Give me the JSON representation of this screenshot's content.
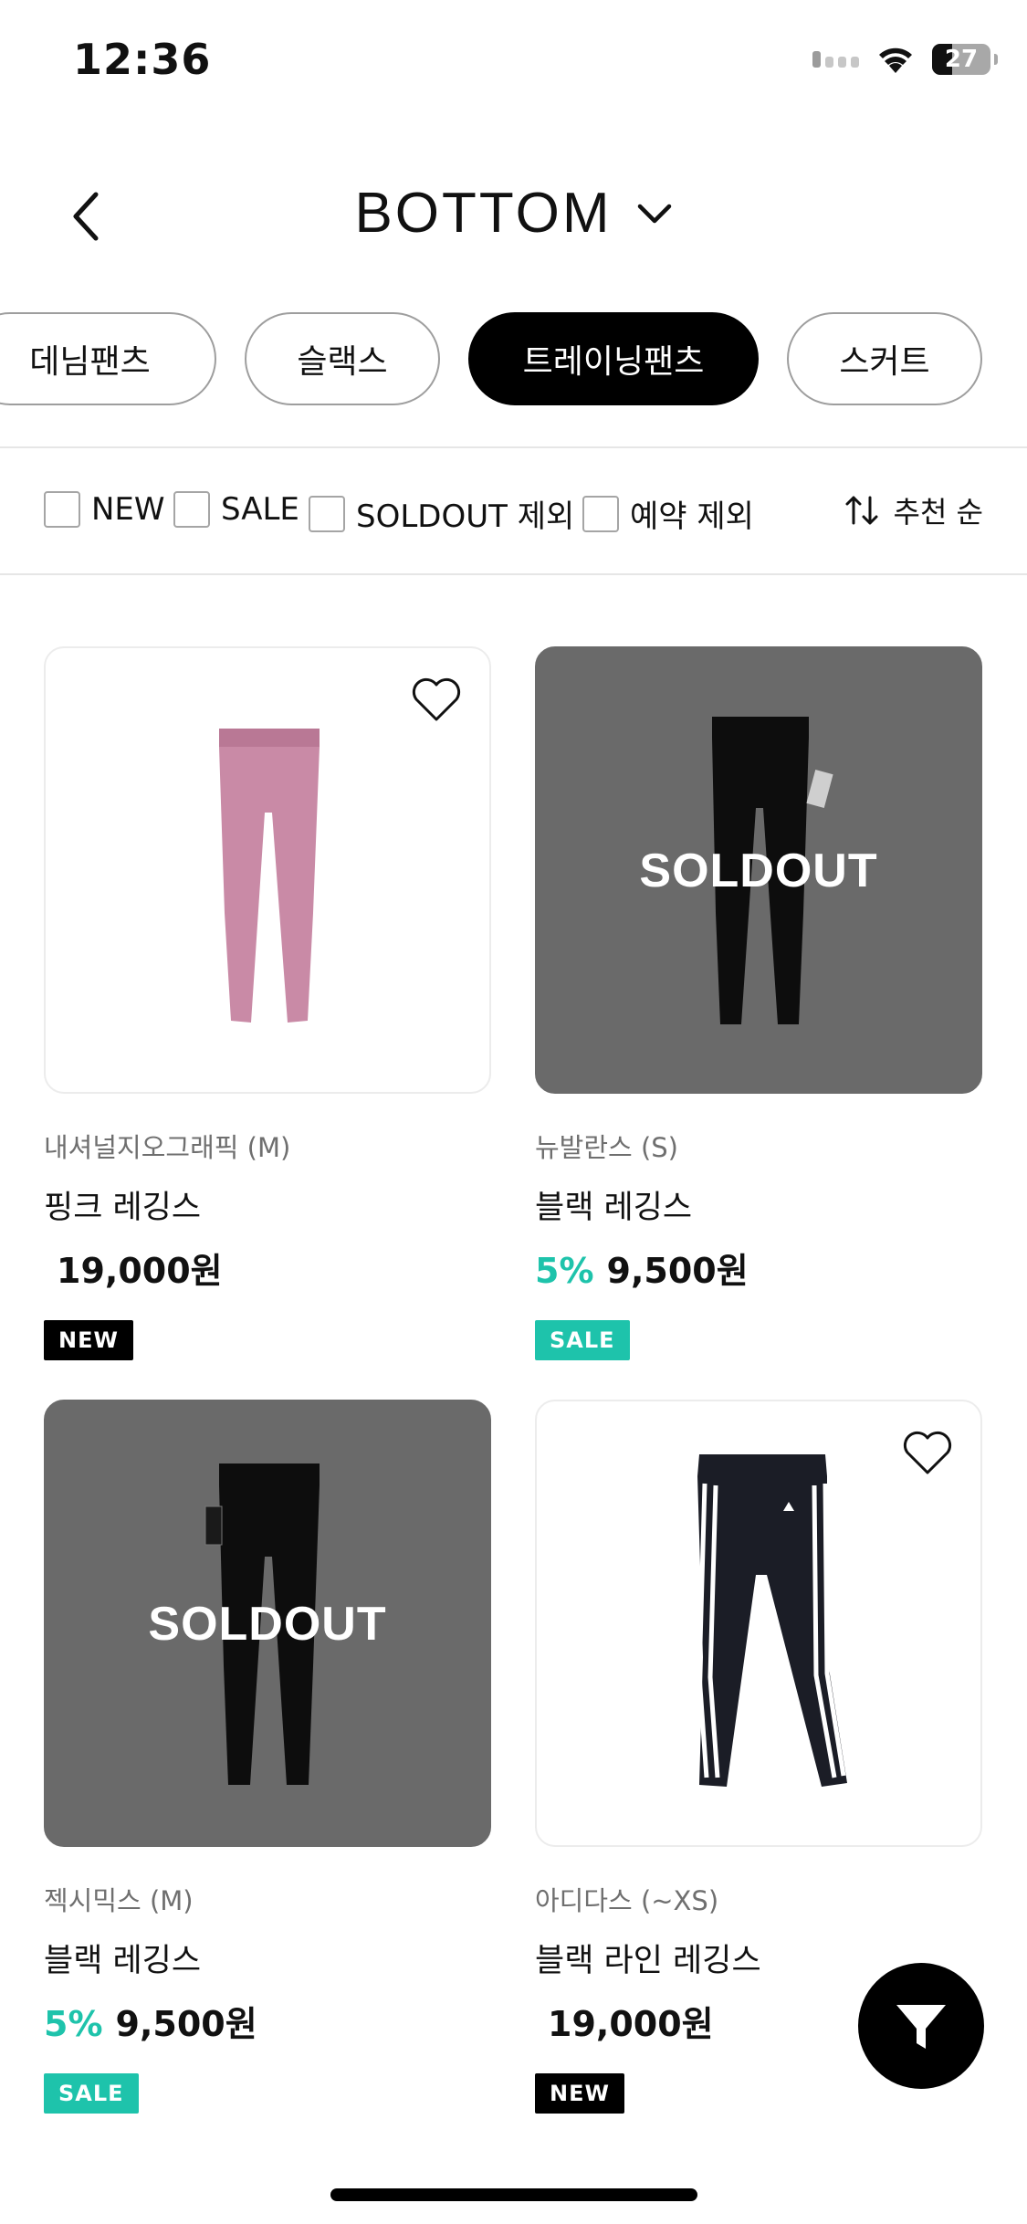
{
  "status_bar": {
    "time": "12:36",
    "battery": "27",
    "icons": [
      "signal-icon",
      "wifi-icon",
      "battery-icon"
    ]
  },
  "header": {
    "title": "BOTTOM",
    "back_icon": "chevron-left-icon",
    "dropdown_icon": "chevron-down-icon"
  },
  "categories": [
    {
      "label": "데님팬츠",
      "active": false
    },
    {
      "label": "슬랙스",
      "active": false
    },
    {
      "label": "트레이닝팬츠",
      "active": true
    },
    {
      "label": "스커트",
      "active": false
    }
  ],
  "filters": [
    {
      "label": "NEW",
      "checked": false
    },
    {
      "label": "SALE",
      "checked": false
    },
    {
      "label": "SOLDOUT 제외",
      "checked": false
    },
    {
      "label": "예약 제외",
      "checked": false
    }
  ],
  "sort": {
    "label": "추천 순",
    "icon": "sort-arrows-icon"
  },
  "products": [
    {
      "brand": "내셔널지오그래픽 (M)",
      "name": "핑크 레깅스",
      "discount": "",
      "price": "19,000원",
      "badge": "NEW",
      "soldout": false,
      "overlay": "",
      "color": "#c98aa6"
    },
    {
      "brand": "뉴발란스 (S)",
      "name": "블랙 레깅스",
      "discount": "5%",
      "price": "9,500원",
      "badge": "SALE",
      "soldout": true,
      "overlay": "SOLDOUT",
      "color": "#0d0d0d"
    },
    {
      "brand": "젝시믹스 (M)",
      "name": "블랙 레깅스",
      "discount": "5%",
      "price": "9,500원",
      "badge": "SALE",
      "soldout": true,
      "overlay": "SOLDOUT",
      "color": "#0d0d0d"
    },
    {
      "brand": "아디다스 (~XS)",
      "name": "블랙 라인 레깅스",
      "discount": "",
      "price": "19,000원",
      "badge": "NEW",
      "soldout": false,
      "overlay": "",
      "color": "#1b1d26"
    }
  ],
  "colors": {
    "accent": "#1ec3ab",
    "active_chip": "#000000",
    "soldout_overlay": "#6a6a6a"
  },
  "fab": {
    "icon": "filter-icon"
  }
}
